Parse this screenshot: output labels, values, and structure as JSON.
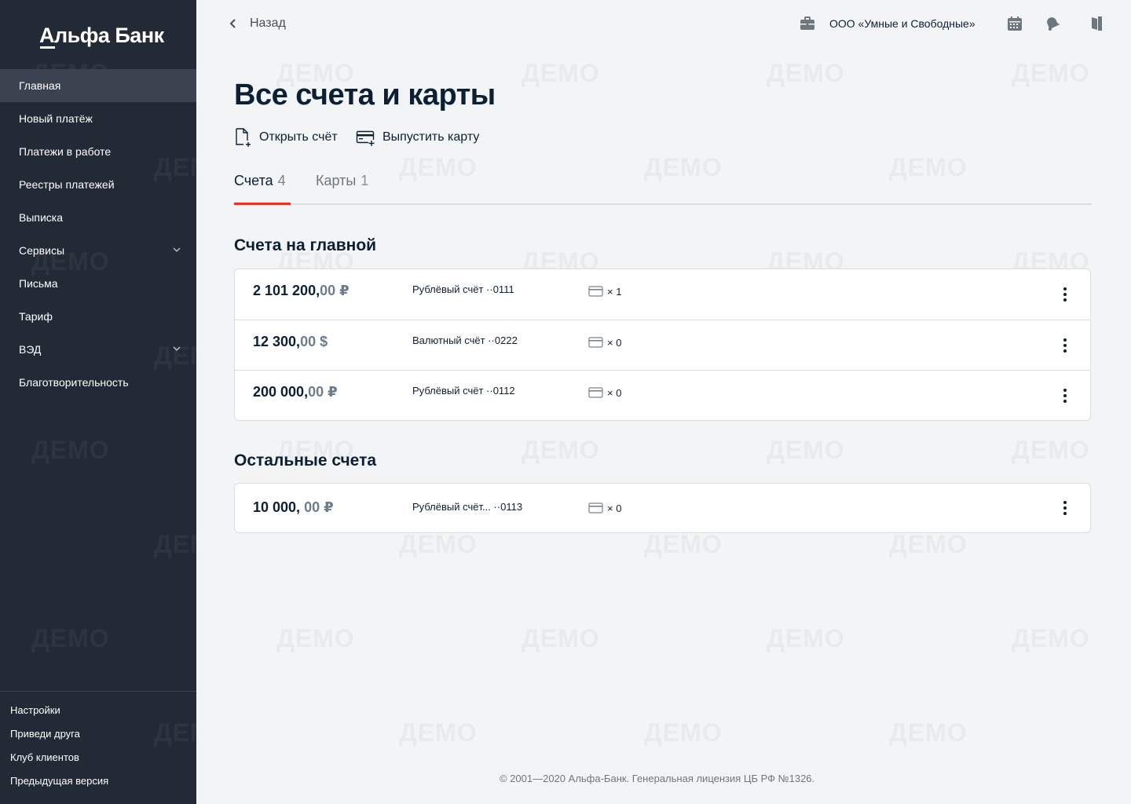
{
  "brand": {
    "logo_text": "Альфа Банк",
    "accent_color": "#ef3124",
    "sidebar_color": "#222a35"
  },
  "watermark": "ДЕМО",
  "sidebar": {
    "items": [
      {
        "label": "Главная",
        "active": true,
        "expandable": false
      },
      {
        "label": "Новый платёж",
        "active": false,
        "expandable": false
      },
      {
        "label": "Платежи в работе",
        "active": false,
        "expandable": false
      },
      {
        "label": "Реестры платежей",
        "active": false,
        "expandable": false
      },
      {
        "label": "Выписка",
        "active": false,
        "expandable": false
      },
      {
        "label": "Сервисы",
        "active": false,
        "expandable": true
      },
      {
        "label": "Письма",
        "active": false,
        "expandable": false
      },
      {
        "label": "Тариф",
        "active": false,
        "expandable": false
      },
      {
        "label": "ВЭД",
        "active": false,
        "expandable": true
      },
      {
        "label": "Благотворительность",
        "active": false,
        "expandable": false
      }
    ],
    "bottom_items": [
      {
        "label": "Настройки"
      },
      {
        "label": "Приведи друга"
      },
      {
        "label": "Клуб клиентов"
      },
      {
        "label": "Предыдущая версия"
      }
    ]
  },
  "header": {
    "back_label": "Назад",
    "company_name": "ООО «Умные и Свободные»",
    "icons": [
      "briefcase-icon",
      "calendar-icon",
      "bell-icon",
      "logout-icon"
    ]
  },
  "main": {
    "title": "Все счета и карты",
    "actions": {
      "open_account": "Открыть счёт",
      "issue_card": "Выпустить карту"
    },
    "tabs": [
      {
        "label": "Счета",
        "count": "4",
        "active": true
      },
      {
        "label": "Карты",
        "count": "1",
        "active": false
      }
    ],
    "sections": [
      {
        "title": "Счета на главной",
        "accounts": [
          {
            "amount_int": "2 101 200,",
            "amount_frac": "00 ₽",
            "name": "Рублёвый счёт ··0111",
            "cards": "× 1"
          },
          {
            "amount_int": "12 300,",
            "amount_frac": "00 $",
            "name": "Валютный счёт ··0222",
            "cards": "× 0"
          },
          {
            "amount_int": "200 000,",
            "amount_frac": "00 ₽",
            "name": "Рублёвый счёт ··0112",
            "cards": "× 0"
          }
        ]
      },
      {
        "title": "Остальные счета",
        "accounts": [
          {
            "amount_int": "10 000,",
            "amount_frac": " 00 ₽",
            "name": "Рублёвый счёт... ··0113",
            "cards": "× 0"
          }
        ]
      }
    ]
  },
  "footer": {
    "text": "© 2001—2020 Альфа-Банк. Генеральная лицензия ЦБ РФ №1326."
  }
}
